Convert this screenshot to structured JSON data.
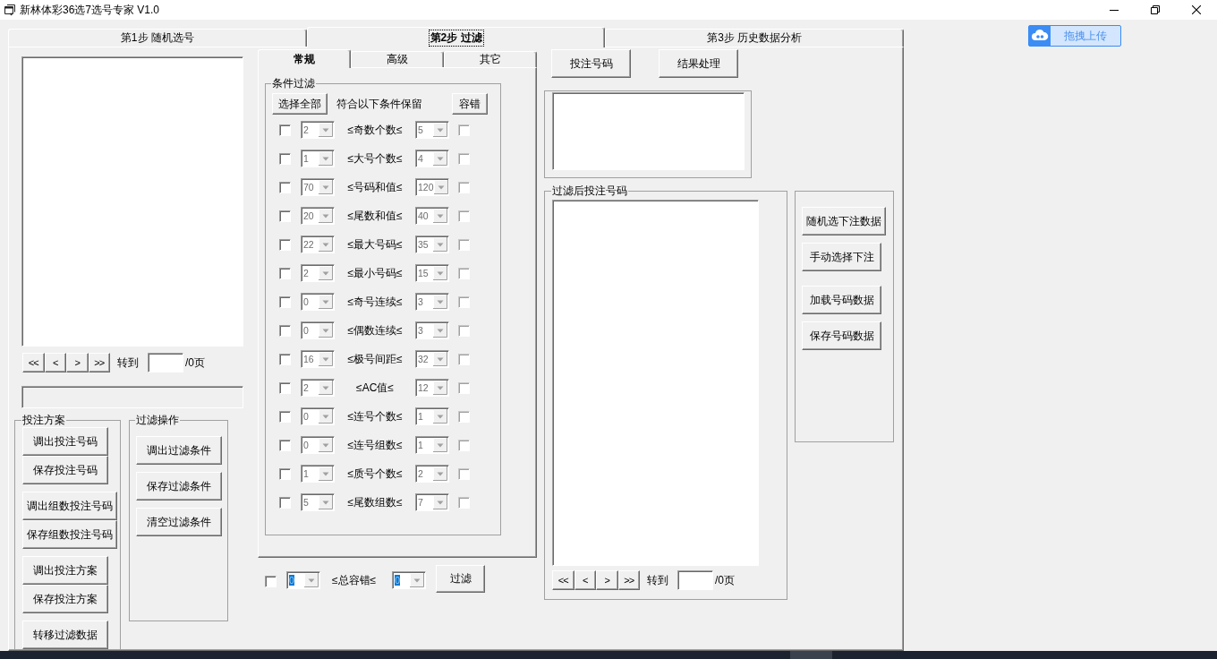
{
  "window": {
    "title": "新林体彩36选7选号专家 V1.0"
  },
  "upload_button": {
    "label": "拖拽上传"
  },
  "step_tabs": [
    {
      "label": "第1步 随机选号",
      "selected": false
    },
    {
      "label": "第2步 过滤",
      "selected": true
    },
    {
      "label": "第3步 历史数据分析",
      "selected": false
    }
  ],
  "left_panel": {
    "pager": {
      "buttons": [
        "<<",
        "<",
        ">",
        ">>"
      ],
      "goto_label": "转到",
      "page_count": "/0页"
    },
    "bet_plan": {
      "title": "投注方案",
      "buttons": [
        "调出投注号码",
        "保存投注号码",
        "调出组数投注号码",
        "保存组数投注号码",
        "调出投注方案",
        "保存投注方案",
        "转移过滤数据"
      ]
    },
    "filter_ops": {
      "title": "过滤操作",
      "buttons": [
        "调出过滤条件",
        "保存过滤条件",
        "清空过滤条件"
      ]
    }
  },
  "filter_tabs": [
    {
      "label": "常规",
      "selected": true
    },
    {
      "label": "高级",
      "selected": false
    },
    {
      "label": "其它",
      "selected": false
    }
  ],
  "condition_filter": {
    "title": "条件过滤",
    "select_all_button": "选择全部",
    "hint": "符合以下条件保留",
    "tolerance_button": "容错",
    "rows": [
      {
        "checked": false,
        "min": "2",
        "label": "≤奇数个数≤",
        "max": "5",
        "tolerance": false
      },
      {
        "checked": false,
        "min": "1",
        "label": "≤大号个数≤",
        "max": "4",
        "tolerance": false
      },
      {
        "checked": false,
        "min": "70",
        "label": "≤号码和值≤",
        "max": "120",
        "tolerance": false
      },
      {
        "checked": false,
        "min": "20",
        "label": "≤尾数和值≤",
        "max": "40",
        "tolerance": false
      },
      {
        "checked": false,
        "min": "22",
        "label": "≤最大号码≤",
        "max": "35",
        "tolerance": false
      },
      {
        "checked": false,
        "min": "2",
        "label": "≤最小号码≤",
        "max": "15",
        "tolerance": false
      },
      {
        "checked": false,
        "min": "0",
        "label": "≤奇号连续≤",
        "max": "3",
        "tolerance": false
      },
      {
        "checked": false,
        "min": "0",
        "label": "≤偶数连续≤",
        "max": "3",
        "tolerance": false
      },
      {
        "checked": false,
        "min": "16",
        "label": "≤极号间距≤",
        "max": "32",
        "tolerance": false
      },
      {
        "checked": false,
        "min": "2",
        "label": "≤AC值≤",
        "max": "12",
        "tolerance": false
      },
      {
        "checked": false,
        "min": "0",
        "label": "≤连号个数≤",
        "max": "1",
        "tolerance": false
      },
      {
        "checked": false,
        "min": "0",
        "label": "≤连号组数≤",
        "max": "1",
        "tolerance": false
      },
      {
        "checked": false,
        "min": "1",
        "label": "≤质号个数≤",
        "max": "2",
        "tolerance": false
      },
      {
        "checked": false,
        "min": "5",
        "label": "≤尾数组数≤",
        "max": "7",
        "tolerance": false
      }
    ]
  },
  "total_tolerance": {
    "checked": false,
    "min": {
      "value": "0",
      "highlighted": true
    },
    "label": "≤总容错≤",
    "max": {
      "value": "0",
      "highlighted": true
    },
    "filter_button": "过滤"
  },
  "right_panel": {
    "buttons": [
      "投注号码",
      "结果处理"
    ],
    "filtered_group": {
      "title": "过滤后投注号码",
      "pager": {
        "buttons": [
          "<<",
          "<",
          ">",
          ">>"
        ],
        "goto_label": "转到",
        "page_count": "/0页"
      }
    },
    "action_buttons": [
      "随机选下注数据",
      "手动选择下注",
      "加载号码数据",
      "保存号码数据"
    ]
  }
}
